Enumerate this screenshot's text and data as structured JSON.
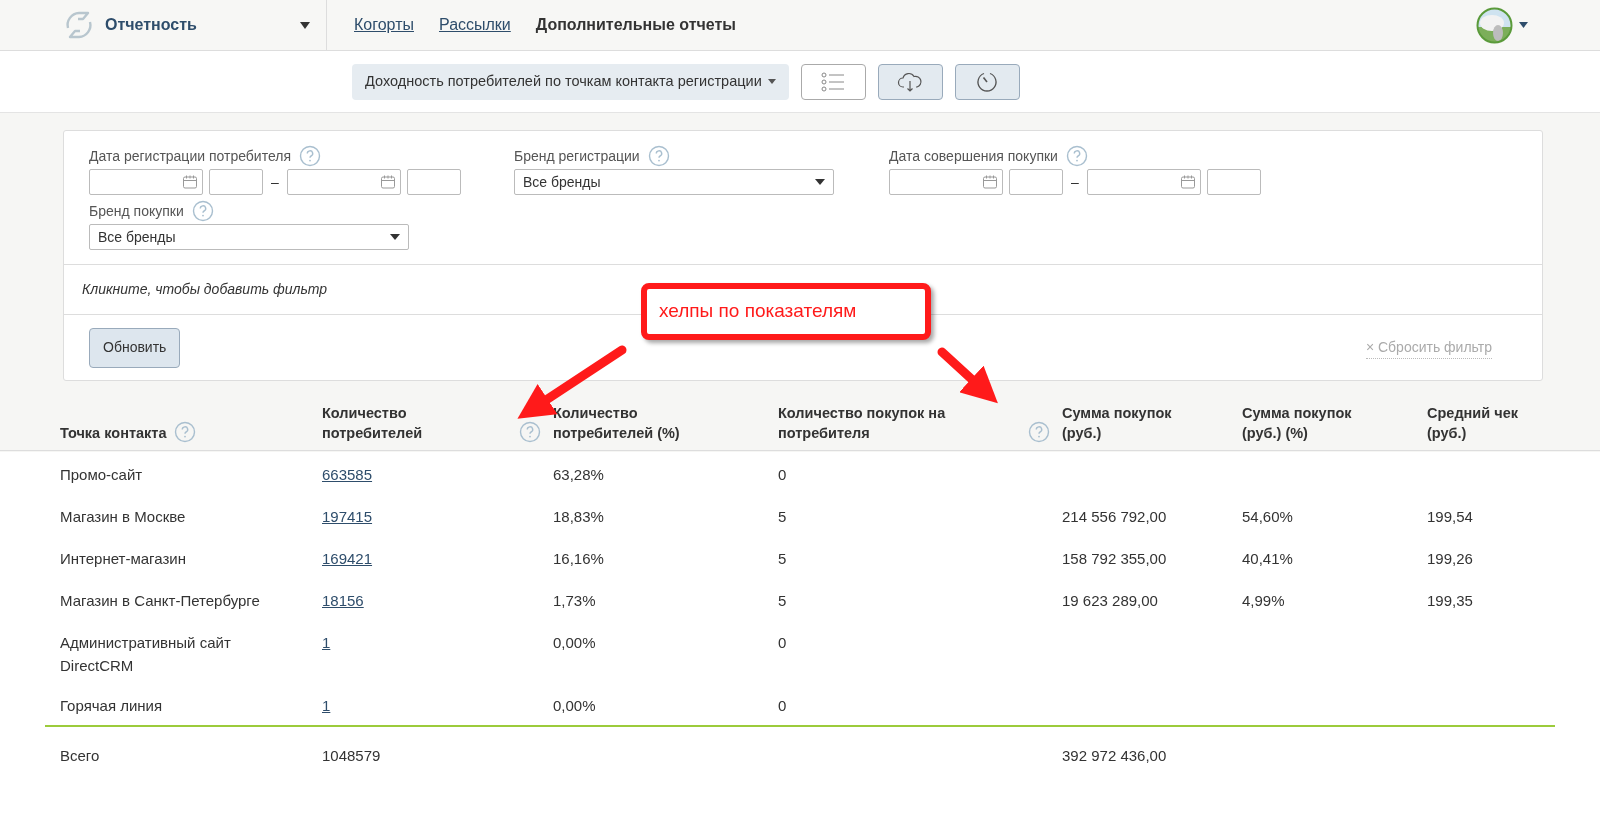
{
  "header": {
    "title": "Отчетность",
    "nav": [
      {
        "label": "Когорты",
        "selected": false
      },
      {
        "label": "Рассылки",
        "selected": false
      },
      {
        "label": "Дополнительные отчеты",
        "selected": true
      }
    ]
  },
  "toolbar": {
    "report": "Доходность потребителей по точкам контакта регистрации"
  },
  "filters": {
    "fields": [
      {
        "kind": "daterange",
        "label": "Дата регистрации потребителя",
        "dash": "–"
      },
      {
        "kind": "select",
        "label": "Бренд регистрации",
        "value": "Все бренды"
      },
      {
        "kind": "daterange",
        "label": "Дата совершения покупки",
        "dash": "–"
      },
      {
        "kind": "select",
        "label": "Бренд покупки",
        "value": "Все бренды"
      }
    ],
    "add_hint": "Кликните, чтобы добавить фильтр",
    "update_button": "Обновить",
    "reset_link": "× Сбросить фильтр"
  },
  "annotation": {
    "text": "хелпы по показателям"
  },
  "table": {
    "columns": [
      {
        "label": "Точка контакта",
        "help": true
      },
      {
        "label": "Количество потребителей",
        "help": true
      },
      {
        "label": "Количество потребителей (%)",
        "help": false
      },
      {
        "label": "Количество покупок на потребителя",
        "help": true
      },
      {
        "label": "Сумма покупок (руб.)",
        "help": false
      },
      {
        "label": "Сумма покупок (руб.) (%)",
        "help": false
      },
      {
        "label": "Средний чек (руб.)",
        "help": false
      }
    ],
    "rows": [
      {
        "cells": [
          "Промо-сайт",
          "663585",
          "63,28%",
          "0",
          null,
          null,
          null
        ]
      },
      {
        "cells": [
          "Магазин в Москве",
          "197415",
          "18,83%",
          "5",
          "214 556 792,00",
          "54,60%",
          "199,54"
        ]
      },
      {
        "cells": [
          "Интернет-магазин",
          "169421",
          "16,16%",
          "5",
          "158 792 355,00",
          "40,41%",
          "199,26"
        ]
      },
      {
        "cells": [
          "Магазин в Санкт-Петербурге",
          "18156",
          "1,73%",
          "5",
          "19 623 289,00",
          "4,99%",
          "199,35"
        ]
      },
      {
        "cells": [
          "Административный сайт DirectCRM",
          "1",
          "0,00%",
          "0",
          null,
          null,
          null
        ]
      },
      {
        "cells": [
          "Горячая линия",
          "1",
          "0,00%",
          "0",
          null,
          null,
          null
        ]
      }
    ],
    "total": {
      "label": "Всего",
      "consumers": "1048579",
      "purchase_sum": "392 972 436,00"
    }
  }
}
